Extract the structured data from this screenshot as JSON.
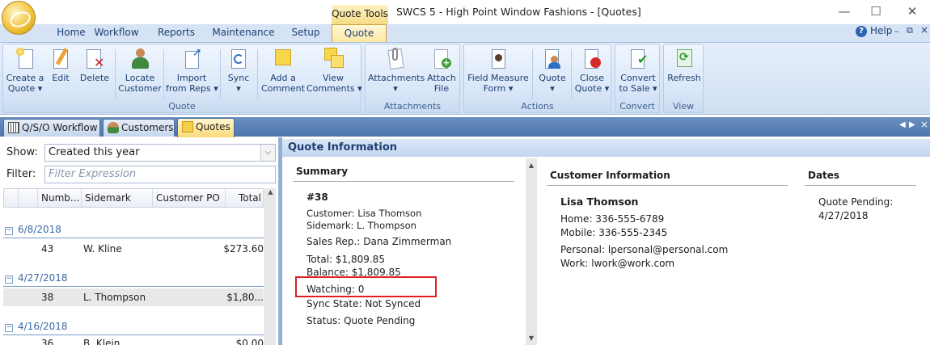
{
  "window": {
    "context_tab": "Quote Tools",
    "title": "SWCS 5 - High Point Window Fashions - [Quotes]",
    "minimize": "—",
    "maximize": "☐",
    "close": "✕"
  },
  "ribbon_tabs": [
    "Home",
    "Workflow",
    "Reports",
    "Maintenance",
    "Setup",
    "Quote"
  ],
  "help": {
    "label": "Help"
  },
  "ribbon": {
    "quote_group": {
      "label": "Quote",
      "create": "Create a\nQuote ▾",
      "edit": "Edit",
      "delete": "Delete",
      "locate": "Locate\nCustomer",
      "import": "Import\nfrom Reps ▾",
      "sync": "Sync\n▾",
      "add_comment": "Add a\nComment",
      "view_comments": "View\nComments ▾"
    },
    "attachments_group": {
      "label": "Attachments",
      "attachments": "Attachments\n▾",
      "attach_file": "Attach\nFile"
    },
    "actions_group": {
      "label": "Actions",
      "field_measure": "Field Measure\nForm ▾",
      "quote": "Quote\n▾",
      "close_quote": "Close\nQuote ▾"
    },
    "convert_group": {
      "label": "Convert",
      "convert": "Convert\nto Sale ▾"
    },
    "view_group": {
      "label": "View",
      "refresh": "Refresh"
    }
  },
  "doc_tabs": [
    "Q/S/O Workflow",
    "Customers",
    "Quotes"
  ],
  "filter": {
    "show_label": "Show:",
    "show_value": "Created this year",
    "filter_label": "Filter:",
    "filter_placeholder": "Filter Expression"
  },
  "grid": {
    "columns": [
      "Numb...",
      "Sidemark",
      "Customer PO",
      "Total"
    ],
    "groups": [
      {
        "date": "6/8/2018",
        "rows": [
          {
            "number": "43",
            "sidemark": "W. Kline",
            "po": "",
            "total": "$273.60"
          }
        ]
      },
      {
        "date": "4/27/2018",
        "rows": [
          {
            "number": "38",
            "sidemark": "L. Thompson",
            "po": "",
            "total": "$1,80..."
          }
        ]
      },
      {
        "date": "4/16/2018",
        "rows": [
          {
            "number": "36",
            "sidemark": "B. Klein",
            "po": "",
            "total": "$0.00"
          }
        ]
      }
    ]
  },
  "quote_info": {
    "header": "Quote Information",
    "summary": {
      "title": "Summary",
      "number": "#38",
      "customer": "Customer: Lisa Thomson",
      "sidemark": "Sidemark: L. Thompson",
      "sales_rep": "Sales Rep.: Dana Zimmerman",
      "total": "Total: $1,809.85",
      "balance": "Balance: $1,809.85",
      "watching": "Watching: 0",
      "sync_state": "Sync State: Not Synced",
      "status": "Status: Quote Pending"
    },
    "customer_info": {
      "title": "Customer Information",
      "name": "Lisa Thomson",
      "home": "Home: 336-555-6789",
      "mobile": "Mobile: 336-555-2345",
      "personal": "Personal: lpersonal@personal.com",
      "work": "Work: lwork@work.com"
    },
    "dates": {
      "title": "Dates",
      "quote_pending_label": "Quote Pending:",
      "quote_pending_date": "4/27/2018"
    }
  },
  "colors": {
    "highlight_box": "#e0201f",
    "accent": "#1e3f73"
  }
}
